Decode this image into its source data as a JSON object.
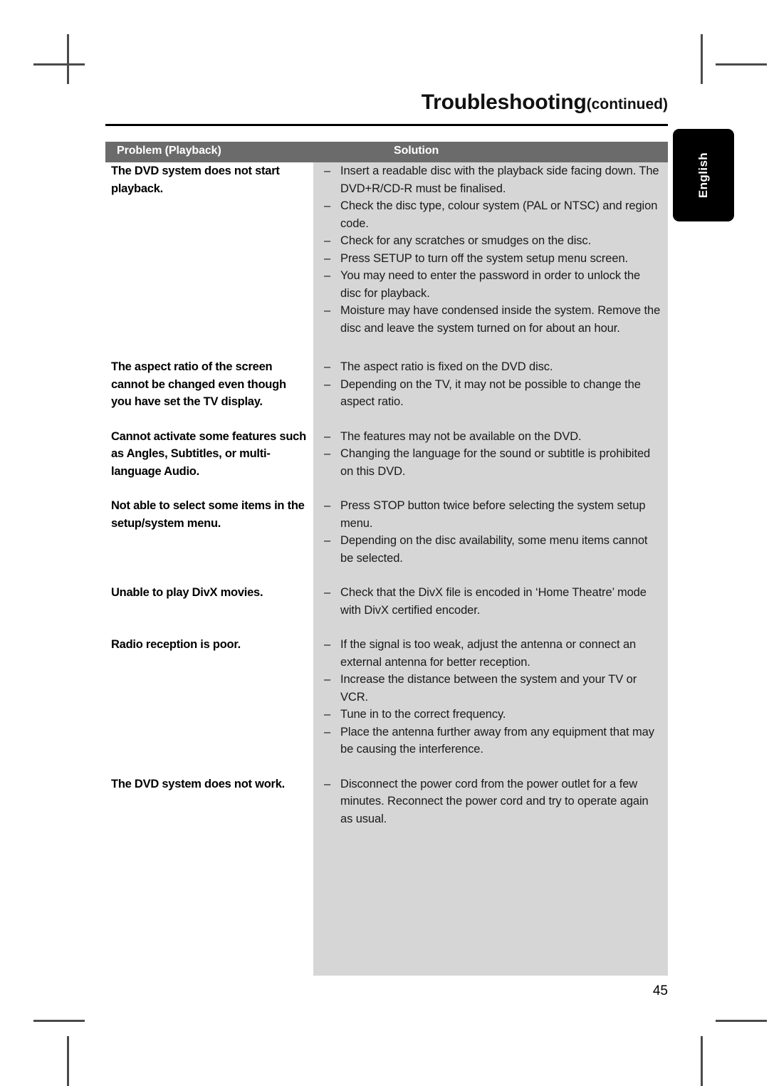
{
  "header": {
    "title": "Troubleshooting",
    "title_suffix": "(continued)"
  },
  "side_tab": {
    "label": "English"
  },
  "table": {
    "columns": {
      "problem": "Problem (Playback)",
      "solution": "Solution"
    },
    "dash": "–",
    "rows": [
      {
        "problem": "The DVD system does not start playback.",
        "solutions": [
          "Insert a readable disc with the playback side facing down. The DVD+R/CD-R must be finalised.",
          "Check the disc type, colour system (PAL or NTSC) and region code.",
          "Check for any scratches or smudges on the disc.",
          "Press SETUP to turn off the system setup menu screen.",
          "You may need to enter the password in order to unlock the disc for playback.",
          "Moisture may have condensed inside the system. Remove the disc and leave the system turned on for about an hour."
        ]
      },
      {
        "problem": "The aspect ratio of the screen cannot be changed even though you have set the TV display.",
        "solutions": [
          "The aspect ratio is fixed on the DVD disc.",
          "Depending on the TV, it may not be possible to change the aspect ratio."
        ]
      },
      {
        "problem": "Cannot activate some features such as Angles, Subtitles, or multi-language Audio.",
        "solutions": [
          "The features may not be available on the DVD.",
          "Changing the language for the sound or subtitle is prohibited on this DVD."
        ]
      },
      {
        "problem": "Not able to select some items in the setup/system menu.",
        "solutions": [
          "Press STOP button twice before selecting the system setup menu.",
          "Depending on the disc availability, some menu items cannot be selected."
        ]
      },
      {
        "problem": "Unable to play DivX movies.",
        "solutions": [
          "Check that the DivX file is encoded in ‘Home Theatre’ mode with DivX certified encoder."
        ]
      },
      {
        "problem": "Radio reception is poor.",
        "solutions": [
          "If the signal is too weak, adjust the antenna or connect an external antenna for better reception.",
          "Increase the distance between the system and your TV or VCR.",
          "Tune in to the correct frequency.",
          "Place the antenna further away from any equipment that may be causing the interference."
        ]
      },
      {
        "problem": "The DVD system does not work.",
        "solutions": [
          "Disconnect the power cord from the power outlet for a few minutes. Reconnect the power cord and try to operate again as usual."
        ]
      }
    ]
  },
  "footer": {
    "page_number": "45"
  }
}
